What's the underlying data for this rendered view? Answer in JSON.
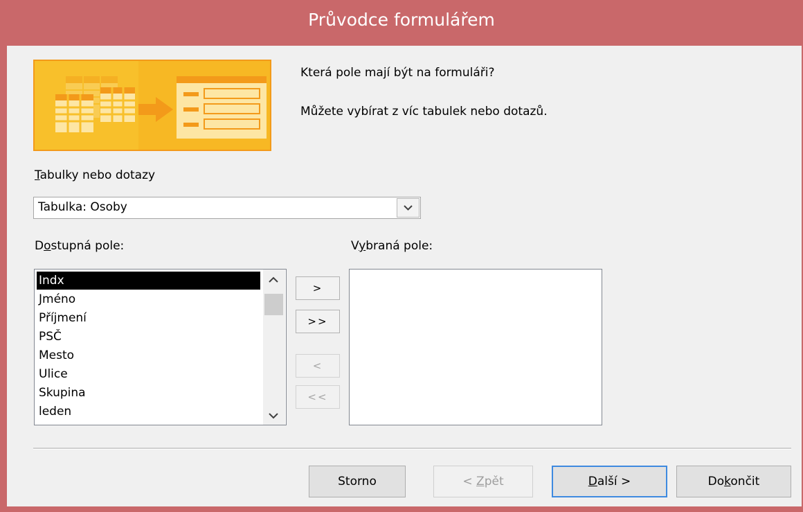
{
  "window": {
    "title": "Průvodce formulářem"
  },
  "header": {
    "question": "Která pole mají být na formuláři?",
    "hint": "Můžete vybírat z víc tabulek nebo dotazů."
  },
  "tables": {
    "label_accel": "T",
    "label_rest": "abulky nebo dotazy",
    "selected": "Tabulka: Osoby"
  },
  "available": {
    "label_pre": "D",
    "label_accel": "o",
    "label_rest": "stupná pole:",
    "items": [
      "Indx",
      "Jméno",
      "Příjmení",
      "PSČ",
      "Mesto",
      "Ulice",
      "Skupina",
      "leden"
    ],
    "selected_index": 0
  },
  "selected_fields": {
    "label_pre": "V",
    "label_accel": "y",
    "label_rest": "braná pole:",
    "items": []
  },
  "move_buttons": {
    "add_one": ">",
    "add_all": ">>",
    "remove_one": "<",
    "remove_all": "<<"
  },
  "footer": {
    "cancel": "Storno",
    "back_pre": "< ",
    "back_accel": "Z",
    "back_rest": "pět",
    "next_accel": "D",
    "next_rest": "alší >",
    "finish_pre": "Do",
    "finish_accel": "k",
    "finish_rest": "ončit"
  },
  "colors": {
    "titlebar": "#c9686a",
    "accent": "#3e8ae0",
    "banner": "#f8c02b"
  }
}
